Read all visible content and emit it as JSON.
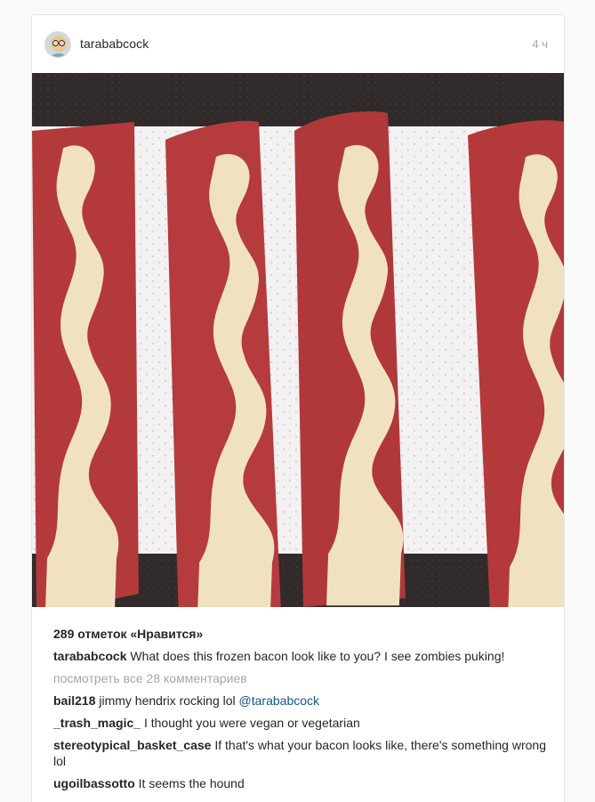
{
  "post": {
    "username": "tarababcock",
    "time": "4 ч"
  },
  "likes": "289 отметок «Нравится»",
  "caption": {
    "user": "tarababcock",
    "text": "What does this frozen bacon look like to you? I see zombies puking!"
  },
  "view_all_comments": "посмотреть все 28 комментариев",
  "comments": [
    {
      "user": "bail218",
      "text": "jimmy hendrix rocking lol",
      "mention": "@tarababcock"
    },
    {
      "user": "_trash_magic_",
      "text": "I thought you were vegan or vegetarian",
      "mention": ""
    },
    {
      "user": "stereotypical_basket_case",
      "text": "If that's what your bacon looks like, there's something wrong lol",
      "mention": ""
    },
    {
      "user": "ugoilbassotto",
      "text": "It seems the hound",
      "mention": ""
    }
  ],
  "colors": {
    "bacon_red": "#b23a3a",
    "fat": "#f1e4c4",
    "paper_towel": "#f4f2f3",
    "counter": "#2e292a",
    "mention": "#125688",
    "muted": "#a5a7aa"
  },
  "icons": {
    "avatar": "user-avatar"
  }
}
